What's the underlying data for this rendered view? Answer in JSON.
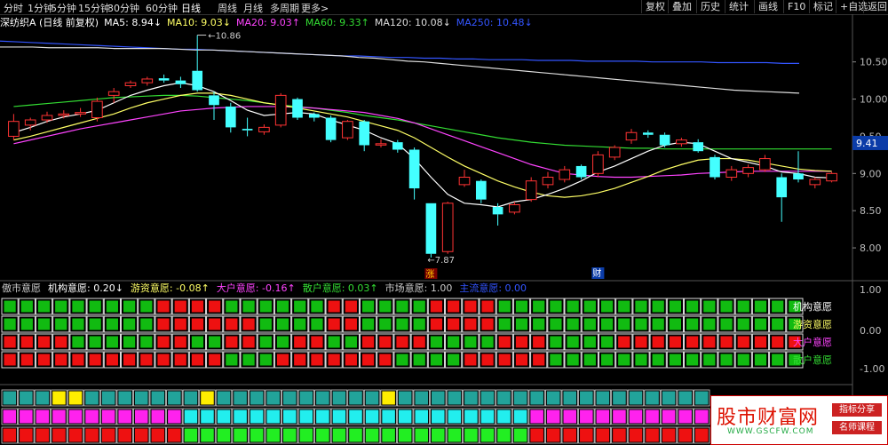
{
  "toolbar": {
    "periods": [
      "分时",
      "1分钟",
      "5分钟",
      "15分钟",
      "30分钟",
      "60分钟",
      "日线",
      "周线",
      "月线",
      "多周期",
      "更多>"
    ],
    "active": "日线",
    "right_buttons": [
      "复权",
      "叠加",
      "历史",
      "统计",
      "画线",
      "F10",
      "标记",
      "+自选",
      "返回"
    ]
  },
  "legend": {
    "name": "深纺织A (日线 前复权)",
    "ma": [
      {
        "label": "MA5: 8.94↓",
        "color": "#ffffff"
      },
      {
        "label": "MA10: 9.03↓",
        "color": "#ffff66"
      },
      {
        "label": "MA20: 9.03↑",
        "color": "#ff44ff"
      },
      {
        "label": "MA60: 9.33↑",
        "color": "#33dd33"
      },
      {
        "label": "MA120: 10.08↓",
        "color": "#dddddd"
      },
      {
        "label": "MA250: 10.48↓",
        "color": "#3355ff"
      }
    ]
  },
  "main_chart": {
    "price_axis": [
      "10.50",
      "10.00",
      "9.50",
      "9.00",
      "8.50",
      "8.00"
    ],
    "current_price": "9.41",
    "high_marker": "10.86",
    "low_marker": "7.87",
    "event_tag_up": "涨",
    "event_tag_fin": "财",
    "up_color": "#ff3333",
    "down_color": "#44ffff"
  },
  "chart_data": {
    "type": "candlestick",
    "candles": [
      {
        "o": 9.5,
        "c": 9.7,
        "h": 9.8,
        "l": 9.45
      },
      {
        "o": 9.65,
        "c": 9.72,
        "h": 9.75,
        "l": 9.58
      },
      {
        "o": 9.72,
        "c": 9.78,
        "h": 9.83,
        "l": 9.68
      },
      {
        "o": 9.78,
        "c": 9.8,
        "h": 9.85,
        "l": 9.74
      },
      {
        "o": 9.8,
        "c": 9.82,
        "h": 9.88,
        "l": 9.76
      },
      {
        "o": 9.75,
        "c": 9.97,
        "h": 10.02,
        "l": 9.7
      },
      {
        "o": 10.05,
        "c": 10.1,
        "h": 10.15,
        "l": 9.95
      },
      {
        "o": 10.18,
        "c": 10.22,
        "h": 10.25,
        "l": 10.15
      },
      {
        "o": 10.22,
        "c": 10.27,
        "h": 10.3,
        "l": 10.18
      },
      {
        "o": 10.28,
        "c": 10.25,
        "h": 10.33,
        "l": 10.22
      },
      {
        "o": 10.25,
        "c": 10.2,
        "h": 10.3,
        "l": 10.15
      },
      {
        "o": 10.38,
        "c": 10.12,
        "h": 10.86,
        "l": 10.1
      },
      {
        "o": 10.05,
        "c": 9.92,
        "h": 10.1,
        "l": 9.72
      },
      {
        "o": 9.9,
        "c": 9.62,
        "h": 9.95,
        "l": 9.55
      },
      {
        "o": 9.6,
        "c": 9.58,
        "h": 9.75,
        "l": 9.5
      },
      {
        "o": 9.56,
        "c": 9.62,
        "h": 9.66,
        "l": 9.52
      },
      {
        "o": 9.65,
        "c": 10.05,
        "h": 10.08,
        "l": 9.62
      },
      {
        "o": 10.0,
        "c": 9.75,
        "h": 10.02,
        "l": 9.72
      },
      {
        "o": 9.8,
        "c": 9.75,
        "h": 9.82,
        "l": 9.7
      },
      {
        "o": 9.75,
        "c": 9.45,
        "h": 9.78,
        "l": 9.42
      },
      {
        "o": 9.48,
        "c": 9.7,
        "h": 9.72,
        "l": 9.45
      },
      {
        "o": 9.7,
        "c": 9.38,
        "h": 9.72,
        "l": 9.3
      },
      {
        "o": 9.4,
        "c": 9.4,
        "h": 9.46,
        "l": 9.35
      },
      {
        "o": 9.42,
        "c": 9.32,
        "h": 9.45,
        "l": 9.28
      },
      {
        "o": 9.32,
        "c": 8.8,
        "h": 9.35,
        "l": 8.65
      },
      {
        "o": 8.6,
        "c": 7.92,
        "h": 8.6,
        "l": 7.87
      },
      {
        "o": 7.95,
        "c": 8.6,
        "h": 8.62,
        "l": 7.92
      },
      {
        "o": 8.85,
        "c": 8.95,
        "h": 9.05,
        "l": 8.82
      },
      {
        "o": 8.9,
        "c": 8.65,
        "h": 8.92,
        "l": 8.6
      },
      {
        "o": 8.55,
        "c": 8.45,
        "h": 8.6,
        "l": 8.3
      },
      {
        "o": 8.48,
        "c": 8.58,
        "h": 8.62,
        "l": 8.45
      },
      {
        "o": 8.65,
        "c": 8.9,
        "h": 8.95,
        "l": 8.62
      },
      {
        "o": 8.85,
        "c": 8.95,
        "h": 9.02,
        "l": 8.8
      },
      {
        "o": 8.92,
        "c": 9.05,
        "h": 9.1,
        "l": 8.88
      },
      {
        "o": 9.1,
        "c": 8.95,
        "h": 9.12,
        "l": 8.92
      },
      {
        "o": 9.0,
        "c": 9.25,
        "h": 9.3,
        "l": 8.95
      },
      {
        "o": 9.22,
        "c": 9.35,
        "h": 9.38,
        "l": 9.18
      },
      {
        "o": 9.45,
        "c": 9.55,
        "h": 9.6,
        "l": 9.4
      },
      {
        "o": 9.55,
        "c": 9.52,
        "h": 9.58,
        "l": 9.48
      },
      {
        "o": 9.52,
        "c": 9.38,
        "h": 9.55,
        "l": 9.35
      },
      {
        "o": 9.4,
        "c": 9.45,
        "h": 9.48,
        "l": 9.36
      },
      {
        "o": 9.42,
        "c": 9.3,
        "h": 9.46,
        "l": 9.28
      },
      {
        "o": 9.22,
        "c": 8.95,
        "h": 9.25,
        "l": 8.92
      },
      {
        "o": 8.95,
        "c": 9.05,
        "h": 9.1,
        "l": 8.9
      },
      {
        "o": 9.0,
        "c": 9.08,
        "h": 9.12,
        "l": 8.95
      },
      {
        "o": 9.05,
        "c": 9.2,
        "h": 9.25,
        "l": 9.02
      },
      {
        "o": 8.95,
        "c": 8.68,
        "h": 9.0,
        "l": 8.35
      },
      {
        "o": 9.0,
        "c": 8.92,
        "h": 9.3,
        "l": 8.88
      },
      {
        "o": 8.85,
        "c": 8.92,
        "h": 8.95,
        "l": 8.8
      },
      {
        "o": 8.9,
        "c": 9.0,
        "h": 9.02,
        "l": 8.88
      }
    ],
    "ma5": [
      9.55,
      9.62,
      9.7,
      9.76,
      9.8,
      9.85,
      9.95,
      10.05,
      10.12,
      10.18,
      10.22,
      10.18,
      10.1,
      9.98,
      9.85,
      9.78,
      9.8,
      9.82,
      9.8,
      9.72,
      9.65,
      9.58,
      9.48,
      9.4,
      9.2,
      8.95,
      8.72,
      8.6,
      8.58,
      8.55,
      8.62,
      8.65,
      8.72,
      8.8,
      8.9,
      9.02,
      9.1,
      9.2,
      9.3,
      9.38,
      9.42,
      9.4,
      9.3,
      9.2,
      9.15,
      9.1,
      9.02,
      9.0,
      8.95,
      8.94
    ],
    "ma10": [
      9.45,
      9.5,
      9.56,
      9.62,
      9.68,
      9.74,
      9.8,
      9.88,
      9.95,
      10.0,
      10.05,
      10.08,
      10.08,
      10.05,
      10.0,
      9.95,
      9.92,
      9.88,
      9.84,
      9.8,
      9.76,
      9.7,
      9.64,
      9.58,
      9.48,
      9.35,
      9.22,
      9.1,
      9.0,
      8.9,
      8.82,
      8.75,
      8.7,
      8.68,
      8.7,
      8.74,
      8.8,
      8.88,
      8.96,
      9.05,
      9.12,
      9.18,
      9.2,
      9.2,
      9.18,
      9.14,
      9.1,
      9.06,
      9.04,
      9.03
    ],
    "ma20": [
      9.4,
      9.45,
      9.5,
      9.55,
      9.6,
      9.64,
      9.68,
      9.72,
      9.76,
      9.8,
      9.84,
      9.86,
      9.88,
      9.89,
      9.9,
      9.9,
      9.9,
      9.89,
      9.88,
      9.86,
      9.84,
      9.82,
      9.78,
      9.74,
      9.68,
      9.6,
      9.52,
      9.44,
      9.36,
      9.28,
      9.2,
      9.12,
      9.06,
      9.0,
      8.98,
      8.96,
      8.95,
      8.95,
      8.96,
      8.97,
      8.98,
      9.0,
      9.01,
      9.02,
      9.03,
      9.03,
      9.03,
      9.03,
      9.03,
      9.03
    ],
    "ma60": [
      9.9,
      9.92,
      9.94,
      9.96,
      9.98,
      10.0,
      10.02,
      10.03,
      10.04,
      10.05,
      10.05,
      10.04,
      10.02,
      10.0,
      9.98,
      9.95,
      9.92,
      9.9,
      9.88,
      9.85,
      9.82,
      9.78,
      9.75,
      9.72,
      9.68,
      9.64,
      9.6,
      9.56,
      9.52,
      9.48,
      9.45,
      9.42,
      9.4,
      9.38,
      9.37,
      9.36,
      9.35,
      9.34,
      9.34,
      9.33,
      9.33,
      9.33,
      9.33,
      9.33,
      9.33,
      9.33,
      9.33,
      9.33,
      9.33,
      9.33
    ],
    "ma120": [
      10.7,
      10.7,
      10.7,
      10.69,
      10.69,
      10.69,
      10.69,
      10.68,
      10.68,
      10.68,
      10.68,
      10.67,
      10.66,
      10.66,
      10.65,
      10.64,
      10.63,
      10.62,
      10.61,
      10.6,
      10.59,
      10.58,
      10.56,
      10.55,
      10.53,
      10.51,
      10.5,
      10.48,
      10.46,
      10.44,
      10.42,
      10.4,
      10.38,
      10.36,
      10.34,
      10.32,
      10.3,
      10.28,
      10.26,
      10.24,
      10.22,
      10.2,
      10.18,
      10.16,
      10.14,
      10.12,
      10.11,
      10.1,
      10.09,
      10.08
    ],
    "ma250": [
      10.78,
      10.77,
      10.76,
      10.75,
      10.74,
      10.73,
      10.72,
      10.71,
      10.7,
      10.69,
      10.68,
      10.67,
      10.67,
      10.66,
      10.65,
      10.64,
      10.63,
      10.62,
      10.61,
      10.6,
      10.59,
      10.58,
      10.58,
      10.57,
      10.56,
      10.56,
      10.55,
      10.55,
      10.54,
      10.54,
      10.53,
      10.53,
      10.53,
      10.52,
      10.52,
      10.52,
      10.51,
      10.51,
      10.51,
      10.51,
      10.5,
      10.5,
      10.5,
      10.5,
      10.49,
      10.49,
      10.49,
      10.49,
      10.48,
      10.48
    ]
  },
  "indicator": {
    "legend": [
      {
        "label": "傲市意愿",
        "color": "#cccccc"
      },
      {
        "label": "机构意愿: 0.20↓",
        "color": "#ffffff"
      },
      {
        "label": "游资意愿: -0.08↑",
        "color": "#ffff66"
      },
      {
        "label": "大户意愿: -0.16↑",
        "color": "#ff44ff"
      },
      {
        "label": "散户意愿: 0.03↑",
        "color": "#33dd33"
      },
      {
        "label": "市场意愿: 1.00",
        "color": "#cccccc"
      },
      {
        "label": "主流意愿: 0.00",
        "color": "#3355ff"
      }
    ],
    "axis": [
      "1.00",
      "0.00",
      "-1.00"
    ],
    "row_labels": [
      {
        "text": "机构意愿",
        "color": "#ffffff"
      },
      {
        "text": "游资意愿",
        "color": "#ffff66"
      },
      {
        "text": "大户意愿",
        "color": "#ff44ff"
      },
      {
        "text": "散户意愿",
        "color": "#33dd33"
      }
    ],
    "rows": [
      "GGGGGGGGGRRRRGGGGGGRRGGGGRRRRGGGGGGGGGGGGGGGGGG",
      "GGGGGGGGGRRRRRRGGGGRRGGGGRRRRGGGGGGGGGGGGGGGGGG",
      "RRRRGGGGGRRGGRRGGRRGGRRRRGGGGRRRGGGGRRRRRRRRRRR",
      "RRRRRRRRRRRRRGGGRRRRRRRGGGGRRRRRGGGGGGGGGGGGGGG"
    ]
  },
  "sub_panel": {
    "rows": [
      "TTTYYTTTTTTTYTTTTTTTTTTYTTTTTTTTTTTTTTTTTTT",
      "MMMMMMMMMMMCCCCCCCCCCCCCCCCCCCCCMMMMMMMMMMM",
      "RRRRRRRRRRRGGGGGGGGGGGGGGGGGGGGGRRRRRRRRRRR"
    ]
  },
  "watermark": {
    "title": "股市财富网",
    "url": "WWW.GSCFW.COM",
    "tag1": "指标分享",
    "tag2": "名师课程"
  }
}
